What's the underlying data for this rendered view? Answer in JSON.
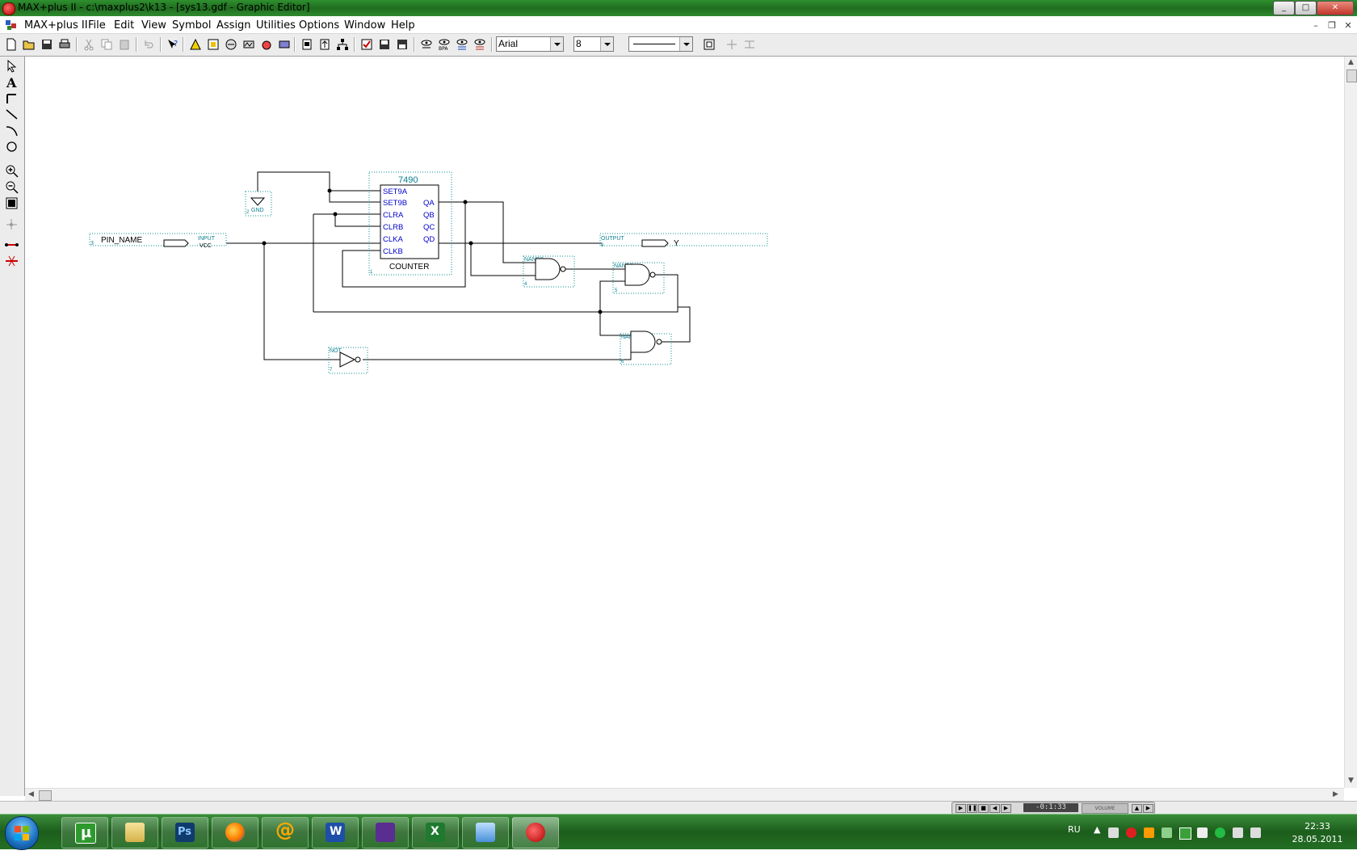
{
  "window": {
    "title": "MAX+plus II - c:\\maxplus2\\k13 - [sys13.gdf - Graphic Editor]",
    "buttons": [
      "_",
      "□",
      "✕"
    ]
  },
  "menu": {
    "app_label": "MAX+plus II",
    "items": [
      "File",
      "Edit",
      "View",
      "Symbol",
      "Assign",
      "Utilities",
      "Options",
      "Window",
      "Help"
    ]
  },
  "toolbar": {
    "font_name": "Arial",
    "font_size": "8"
  },
  "schematic": {
    "counter": {
      "part": "7490",
      "name": "COUNTER",
      "inputs": [
        "SET9A",
        "SET9B",
        "CLRA",
        "CLRB",
        "CLKA",
        "CLKB"
      ],
      "outputs": [
        "QA",
        "QB",
        "QC",
        "QD"
      ],
      "id": "1"
    },
    "input_pin": {
      "name": "PIN_NAME",
      "type": "INPUT",
      "default": "VCC",
      "id": "3"
    },
    "output_pin": {
      "name": "Y",
      "type": "OUTPUT",
      "id": "8"
    },
    "gnd": {
      "label": "GND",
      "id": "2"
    },
    "gates": [
      {
        "type": "NAND2",
        "id": "4"
      },
      {
        "type": "NAND2",
        "id": "5"
      },
      {
        "type": "NAND2",
        "id": "6"
      },
      {
        "type": "NOT",
        "id": "7"
      }
    ]
  },
  "taskbar": {
    "apps": [
      "uTorrent",
      "Explorer",
      "Photoshop",
      "Firefox",
      "Mail.Ru Agent",
      "Word",
      "Visual Studio",
      "Excel",
      "Downloader",
      "MAX+plus II"
    ],
    "language": "RU",
    "time": "22:33",
    "date": "28.05.2011"
  },
  "media": {
    "time_display": "-0:1:33",
    "volume_label": "VOLUME"
  },
  "colors": {
    "title_green": "#2f8f2f",
    "schematic_blue": "#0000cc",
    "schematic_teal": "#0a7f8f",
    "taskbar_green": "#1c5d1c"
  }
}
